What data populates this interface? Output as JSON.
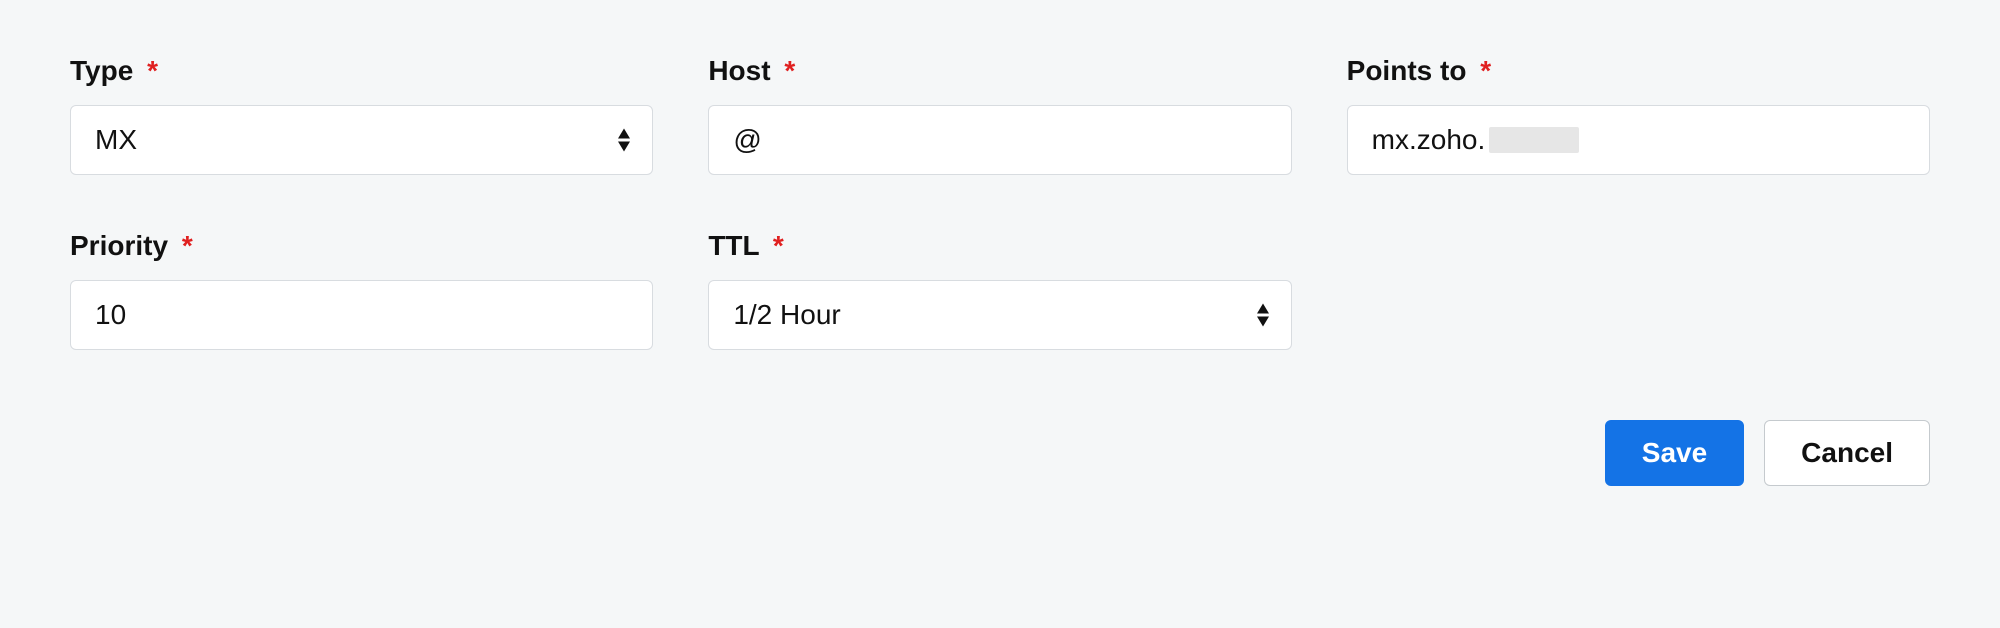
{
  "fields": {
    "type": {
      "label": "Type",
      "value": "MX",
      "required": true
    },
    "host": {
      "label": "Host",
      "value": "@",
      "required": true
    },
    "pointsTo": {
      "label": "Points to",
      "value": "mx.zoho.",
      "required": true
    },
    "priority": {
      "label": "Priority",
      "value": "10",
      "required": true
    },
    "ttl": {
      "label": "TTL",
      "value": "1/2 Hour",
      "required": true
    }
  },
  "actions": {
    "save": "Save",
    "cancel": "Cancel"
  }
}
